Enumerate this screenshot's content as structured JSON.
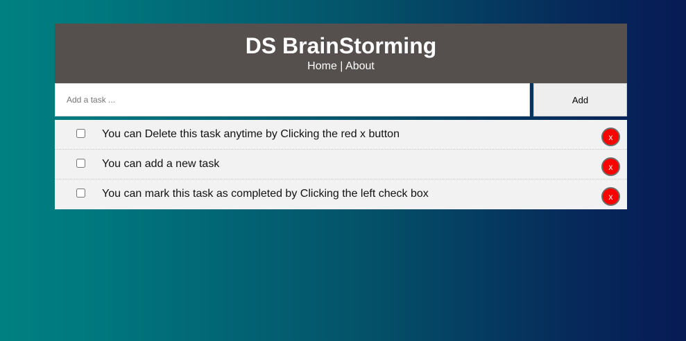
{
  "header": {
    "title": "DS BrainStorming",
    "nav": [
      {
        "label": "Home"
      },
      {
        "label": "About"
      }
    ],
    "nav_separator": "|"
  },
  "input": {
    "placeholder": "Add a task ...",
    "value": "",
    "add_label": "Add"
  },
  "tasks": [
    {
      "text": "You can Delete this task anytime by Clicking the red x button",
      "checked": false,
      "delete_label": "x"
    },
    {
      "text": "You can add a new task",
      "checked": false,
      "delete_label": "x"
    },
    {
      "text": "You can mark this task as completed by Clicking the left check box",
      "checked": false,
      "delete_label": "x"
    }
  ],
  "colors": {
    "header_bg": "#554f4e",
    "delete_button": "#ff0000",
    "task_bg": "#f2f2f2",
    "gradient_start": "#008080",
    "gradient_end": "#071b55"
  }
}
